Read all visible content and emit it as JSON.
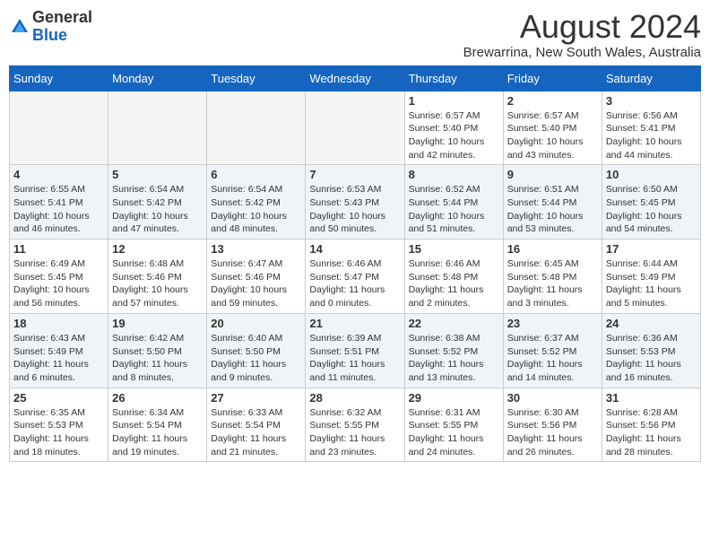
{
  "header": {
    "logo_general": "General",
    "logo_blue": "Blue",
    "month_year": "August 2024",
    "location": "Brewarrina, New South Wales, Australia"
  },
  "weekdays": [
    "Sunday",
    "Monday",
    "Tuesday",
    "Wednesday",
    "Thursday",
    "Friday",
    "Saturday"
  ],
  "weeks": [
    [
      {
        "day": "",
        "info": ""
      },
      {
        "day": "",
        "info": ""
      },
      {
        "day": "",
        "info": ""
      },
      {
        "day": "",
        "info": ""
      },
      {
        "day": "1",
        "info": "Sunrise: 6:57 AM\nSunset: 5:40 PM\nDaylight: 10 hours\nand 42 minutes."
      },
      {
        "day": "2",
        "info": "Sunrise: 6:57 AM\nSunset: 5:40 PM\nDaylight: 10 hours\nand 43 minutes."
      },
      {
        "day": "3",
        "info": "Sunrise: 6:56 AM\nSunset: 5:41 PM\nDaylight: 10 hours\nand 44 minutes."
      }
    ],
    [
      {
        "day": "4",
        "info": "Sunrise: 6:55 AM\nSunset: 5:41 PM\nDaylight: 10 hours\nand 46 minutes."
      },
      {
        "day": "5",
        "info": "Sunrise: 6:54 AM\nSunset: 5:42 PM\nDaylight: 10 hours\nand 47 minutes."
      },
      {
        "day": "6",
        "info": "Sunrise: 6:54 AM\nSunset: 5:42 PM\nDaylight: 10 hours\nand 48 minutes."
      },
      {
        "day": "7",
        "info": "Sunrise: 6:53 AM\nSunset: 5:43 PM\nDaylight: 10 hours\nand 50 minutes."
      },
      {
        "day": "8",
        "info": "Sunrise: 6:52 AM\nSunset: 5:44 PM\nDaylight: 10 hours\nand 51 minutes."
      },
      {
        "day": "9",
        "info": "Sunrise: 6:51 AM\nSunset: 5:44 PM\nDaylight: 10 hours\nand 53 minutes."
      },
      {
        "day": "10",
        "info": "Sunrise: 6:50 AM\nSunset: 5:45 PM\nDaylight: 10 hours\nand 54 minutes."
      }
    ],
    [
      {
        "day": "11",
        "info": "Sunrise: 6:49 AM\nSunset: 5:45 PM\nDaylight: 10 hours\nand 56 minutes."
      },
      {
        "day": "12",
        "info": "Sunrise: 6:48 AM\nSunset: 5:46 PM\nDaylight: 10 hours\nand 57 minutes."
      },
      {
        "day": "13",
        "info": "Sunrise: 6:47 AM\nSunset: 5:46 PM\nDaylight: 10 hours\nand 59 minutes."
      },
      {
        "day": "14",
        "info": "Sunrise: 6:46 AM\nSunset: 5:47 PM\nDaylight: 11 hours\nand 0 minutes."
      },
      {
        "day": "15",
        "info": "Sunrise: 6:46 AM\nSunset: 5:48 PM\nDaylight: 11 hours\nand 2 minutes."
      },
      {
        "day": "16",
        "info": "Sunrise: 6:45 AM\nSunset: 5:48 PM\nDaylight: 11 hours\nand 3 minutes."
      },
      {
        "day": "17",
        "info": "Sunrise: 6:44 AM\nSunset: 5:49 PM\nDaylight: 11 hours\nand 5 minutes."
      }
    ],
    [
      {
        "day": "18",
        "info": "Sunrise: 6:43 AM\nSunset: 5:49 PM\nDaylight: 11 hours\nand 6 minutes."
      },
      {
        "day": "19",
        "info": "Sunrise: 6:42 AM\nSunset: 5:50 PM\nDaylight: 11 hours\nand 8 minutes."
      },
      {
        "day": "20",
        "info": "Sunrise: 6:40 AM\nSunset: 5:50 PM\nDaylight: 11 hours\nand 9 minutes."
      },
      {
        "day": "21",
        "info": "Sunrise: 6:39 AM\nSunset: 5:51 PM\nDaylight: 11 hours\nand 11 minutes."
      },
      {
        "day": "22",
        "info": "Sunrise: 6:38 AM\nSunset: 5:52 PM\nDaylight: 11 hours\nand 13 minutes."
      },
      {
        "day": "23",
        "info": "Sunrise: 6:37 AM\nSunset: 5:52 PM\nDaylight: 11 hours\nand 14 minutes."
      },
      {
        "day": "24",
        "info": "Sunrise: 6:36 AM\nSunset: 5:53 PM\nDaylight: 11 hours\nand 16 minutes."
      }
    ],
    [
      {
        "day": "25",
        "info": "Sunrise: 6:35 AM\nSunset: 5:53 PM\nDaylight: 11 hours\nand 18 minutes."
      },
      {
        "day": "26",
        "info": "Sunrise: 6:34 AM\nSunset: 5:54 PM\nDaylight: 11 hours\nand 19 minutes."
      },
      {
        "day": "27",
        "info": "Sunrise: 6:33 AM\nSunset: 5:54 PM\nDaylight: 11 hours\nand 21 minutes."
      },
      {
        "day": "28",
        "info": "Sunrise: 6:32 AM\nSunset: 5:55 PM\nDaylight: 11 hours\nand 23 minutes."
      },
      {
        "day": "29",
        "info": "Sunrise: 6:31 AM\nSunset: 5:55 PM\nDaylight: 11 hours\nand 24 minutes."
      },
      {
        "day": "30",
        "info": "Sunrise: 6:30 AM\nSunset: 5:56 PM\nDaylight: 11 hours\nand 26 minutes."
      },
      {
        "day": "31",
        "info": "Sunrise: 6:28 AM\nSunset: 5:56 PM\nDaylight: 11 hours\nand 28 minutes."
      }
    ]
  ]
}
